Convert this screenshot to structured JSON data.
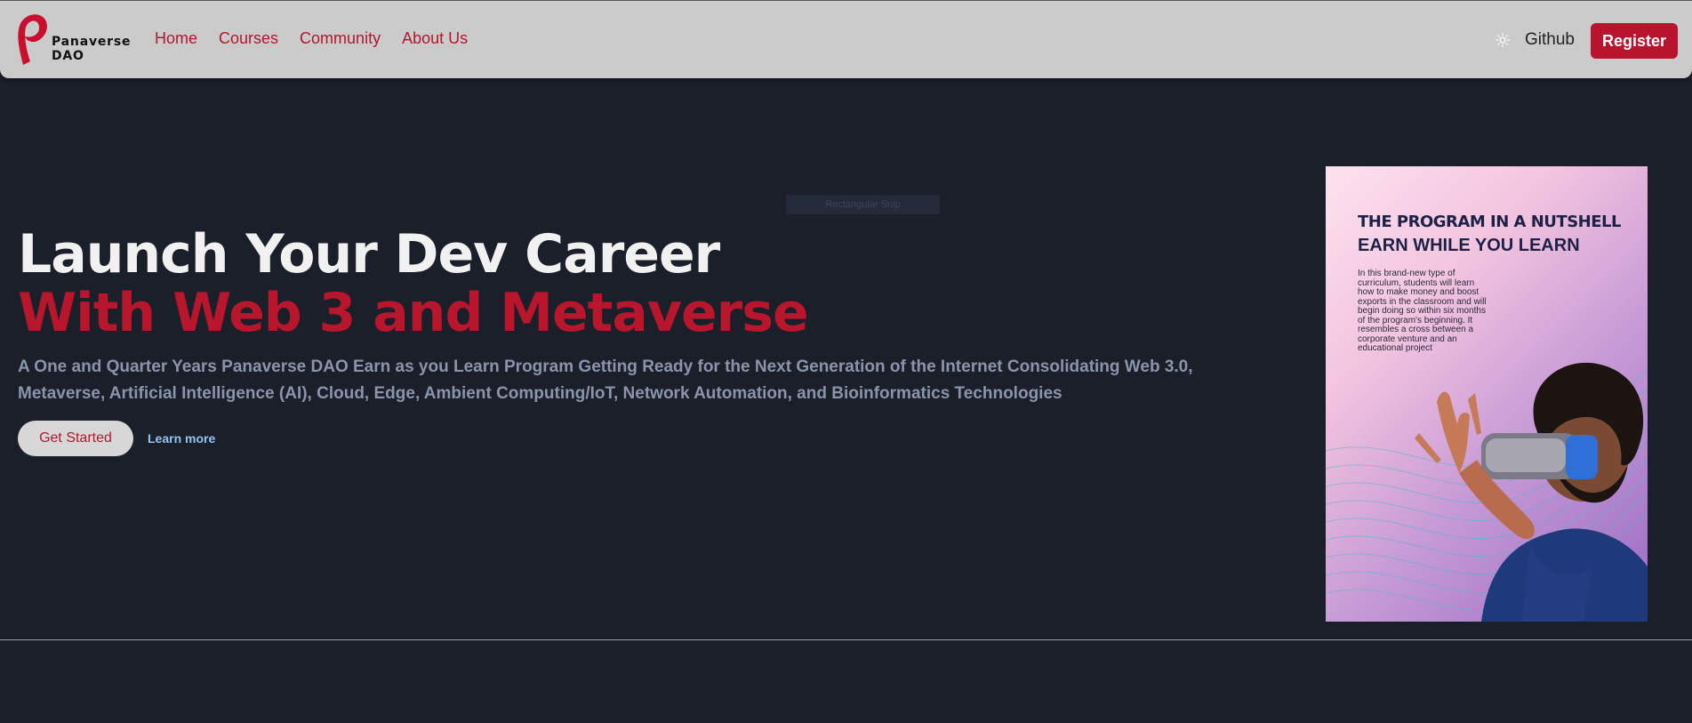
{
  "brand": {
    "line1": "Panaverse",
    "line2": "DAO"
  },
  "nav": {
    "links": [
      "Home",
      "Courses",
      "Community",
      "About Us"
    ],
    "github_label": "Github",
    "register_label": "Register"
  },
  "overlay": {
    "snip_label": "Rectangular Snip"
  },
  "hero": {
    "title_line1": "Launch Your Dev Career",
    "title_line2": "With Web 3 and Metaverse",
    "description": "A One and Quarter Years Panaverse DAO Earn as you Learn Program Getting Ready for the Next Generation of the Internet Consolidating Web 3.0, Metaverse, Artificial Intelligence (AI), Cloud, Edge, Ambient Computing/IoT, Network Automation, and Bioinformatics Technologies",
    "get_started_label": "Get Started",
    "learn_more_label": "Learn more"
  },
  "poster": {
    "heading": "THE PROGRAM IN A NUTSHELL",
    "subheading": "EARN WHILE YOU LEARN",
    "body": "In this brand-new type of curriculum, students will learn how to make money and boost exports in the classroom and will begin doing so within six months of the program's beginning. It resembles a cross between a corporate venture and an educational project"
  },
  "colors": {
    "accent": "#b8142e",
    "navbar_bg": "#cbcbcb",
    "page_bg": "#1b1f2a",
    "description_text": "#8a94ab",
    "learn_more": "#8fc4f5"
  },
  "icons": {
    "theme_toggle": "sun-icon",
    "logo": "panaverse-logo-icon"
  }
}
